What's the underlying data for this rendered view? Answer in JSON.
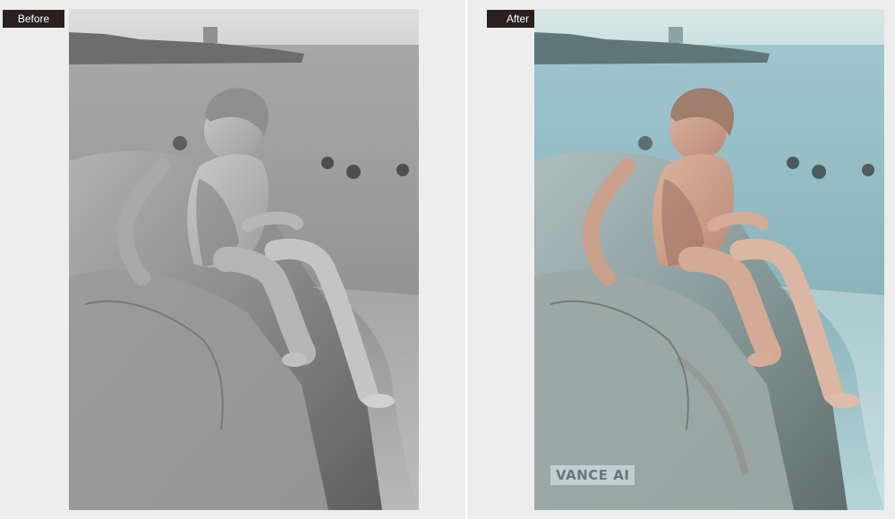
{
  "labels": {
    "before": "Before",
    "after": "After"
  },
  "watermark": {
    "brand": "VANCE AI"
  },
  "colors": {
    "label_bg": "#2a201d",
    "before_sea": "#9a9a9a",
    "after_sea": "#8fb6be",
    "before_rock": "#8a8a8a",
    "after_rock": "#9aa8a7"
  }
}
